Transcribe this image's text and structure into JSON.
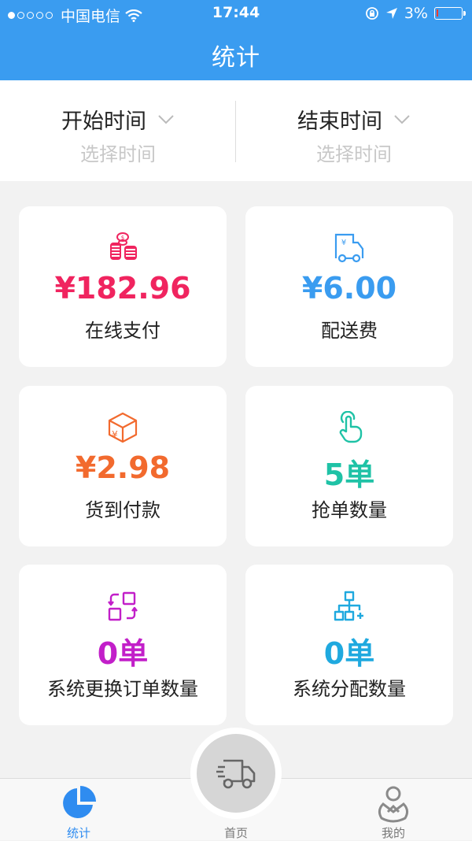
{
  "status_bar": {
    "carrier": "中国电信",
    "time": "17:44",
    "battery": "3%"
  },
  "header": {
    "title": "统计"
  },
  "filters": {
    "start": {
      "label": "开始时间",
      "placeholder": "选择时间"
    },
    "end": {
      "label": "结束时间",
      "placeholder": "选择时间"
    }
  },
  "stats": [
    {
      "value": "¥182.96",
      "label": "在线支付",
      "color": "#f0245f",
      "icon": "coins-icon"
    },
    {
      "value": "¥6.00",
      "label": "配送费",
      "color": "#3a9cf0",
      "icon": "delivery-truck-icon"
    },
    {
      "value": "¥2.98",
      "label": "货到付款",
      "color": "#f26a2e",
      "icon": "package-box-icon"
    },
    {
      "value": "5单",
      "label": "抢单数量",
      "color": "#1fc2a6",
      "icon": "tap-hand-icon"
    },
    {
      "value": "0单",
      "label": "系统更换订单数量",
      "color": "#c21fc9",
      "icon": "swap-order-icon"
    },
    {
      "value": "0单",
      "label": "系统分配数量",
      "color": "#1fa9df",
      "icon": "hierarchy-icon"
    }
  ],
  "tabbar": {
    "stats": "统计",
    "home": "首页",
    "mine": "我的"
  }
}
